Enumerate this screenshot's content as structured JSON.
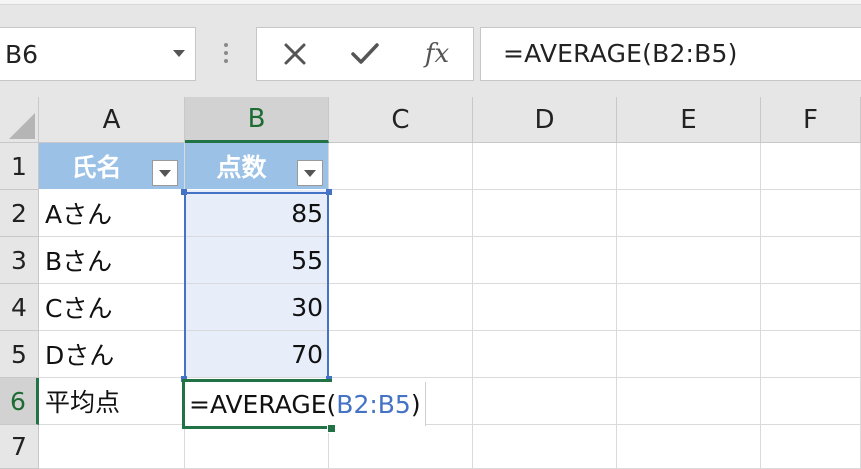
{
  "name_box": {
    "value": "B6"
  },
  "formula_bar": {
    "cancel_icon": "x-icon",
    "enter_icon": "check-icon",
    "function_label": "fx",
    "formula": "=AVERAGE(B2:B5)"
  },
  "columns": [
    "A",
    "B",
    "C",
    "D",
    "E",
    "F"
  ],
  "selected_column": "B",
  "rows": [
    "1",
    "2",
    "3",
    "4",
    "5",
    "6",
    "7"
  ],
  "selected_row": "6",
  "table": {
    "headers": [
      "氏名",
      "点数"
    ],
    "rows": [
      {
        "name": "Aさん",
        "score": "85"
      },
      {
        "name": "Bさん",
        "score": "55"
      },
      {
        "name": "Cさん",
        "score": "30"
      },
      {
        "name": "Dさん",
        "score": "70"
      }
    ]
  },
  "row6": {
    "label": "平均点",
    "edit_prefix": "=AVERAGE(",
    "edit_ref": "B2:B5",
    "edit_suffix": ")"
  },
  "colors": {
    "header_fill": "#9bc2e6",
    "range_fill": "#e7edf9",
    "range_border": "#4472c4",
    "active_border": "#217346"
  }
}
